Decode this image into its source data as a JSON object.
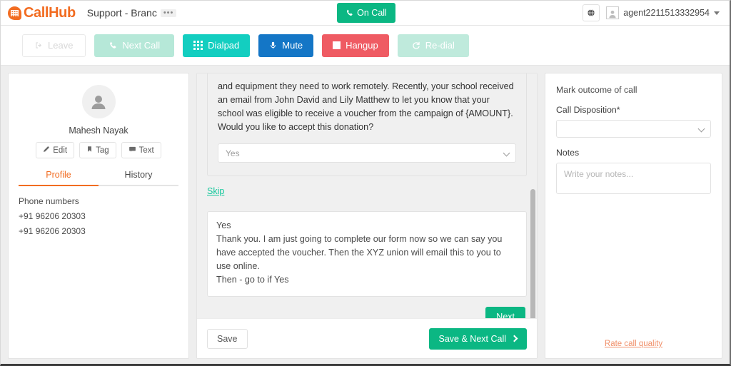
{
  "topbar": {
    "brand": "CallHub",
    "campaign_title": "Support - Branc",
    "campaign_more": "•••",
    "oncall_label": "On Call",
    "phone_icon": "phone-icon",
    "globe_icon": "globe-icon",
    "user_name": "agent2211513332954",
    "avatar_icon": "user-avatar-icon",
    "caret_icon": "chevron-down-icon"
  },
  "actions": {
    "leave": "Leave",
    "next_call": "Next Call",
    "dialpad": "Dialpad",
    "mute": "Mute",
    "hangup": "Hangup",
    "redial": "Re-dial",
    "icons": {
      "leave": "leave-icon",
      "next_call": "phone-icon",
      "dialpad": "dialpad-icon",
      "mute": "microphone-icon",
      "hangup": "stop-square-icon",
      "redial": "refresh-icon"
    }
  },
  "contact": {
    "name": "Mahesh Nayak",
    "avatar_icon": "person-icon",
    "buttons": [
      {
        "label": "Edit",
        "icon": "pencil-icon"
      },
      {
        "label": "Tag",
        "icon": "bookmark-icon"
      },
      {
        "label": "Text",
        "icon": "message-icon"
      }
    ],
    "tabs": [
      {
        "label": "Profile",
        "active": true
      },
      {
        "label": "History",
        "active": false
      }
    ],
    "phone_section_title": "Phone numbers",
    "phones": [
      "+91 96206 20303",
      "+91 96206 20303"
    ]
  },
  "script": {
    "body": "and equipment they need to work remotely. Recently, your school received an email from John David and Lily Matthew to let you know that your school was eligible to receive a voucher from the campaign of {AMOUNT}. Would you like to accept this donation?",
    "answer_select_value": "Yes",
    "skip_label": "Skip",
    "answer_block": "Yes\nThank you. I am just going to complete our form now so we can say you have accepted the voucher. Then the XYZ union will email this to you to use online.\nThen - go to if Yes",
    "next_label": "Next"
  },
  "center_footer": {
    "save_label": "Save",
    "save_next_label": "Save & Next Call",
    "arrow_icon": "chevron-right-icon"
  },
  "disposition": {
    "title": "Mark outcome of call",
    "call_disposition_label": "Call Disposition*",
    "call_disposition_value": "",
    "notes_label": "Notes",
    "notes_placeholder": "Write your notes...",
    "rate_call_quality": "Rate call quality"
  },
  "colors": {
    "brand_orange": "#f26c21",
    "green": "#0bb783",
    "teal": "#13cec0",
    "blue": "#1476c6",
    "red": "#ef5b63",
    "link_teal": "#13c79b",
    "muted_green": "#b6e8d8"
  }
}
